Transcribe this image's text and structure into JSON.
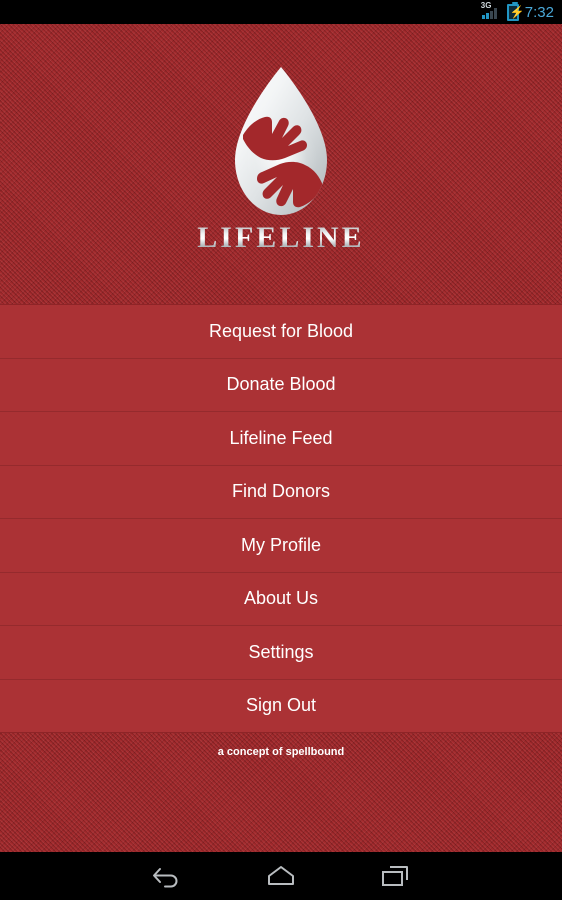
{
  "status_bar": {
    "network_label": "3G",
    "network_icon": "signal-bars-icon",
    "battery_icon": "battery-charging-icon",
    "time": "7:32",
    "time_color": "#4aa8d8",
    "accent_color": "#2196c4"
  },
  "brand": {
    "logo_icon": "blood-drop-hands-logo",
    "wordmark": "LIFELINE",
    "footer_note": "a concept of spellbound"
  },
  "theme": {
    "background_red": "#a3282b",
    "menu_red": "#ab3235",
    "divider_red": "#952a2d",
    "text_white": "#ffffff"
  },
  "menu": {
    "items": [
      {
        "label": "Request for Blood",
        "name": "menu-item-request-for-blood"
      },
      {
        "label": "Donate Blood",
        "name": "menu-item-donate-blood"
      },
      {
        "label": "Lifeline Feed",
        "name": "menu-item-lifeline-feed"
      },
      {
        "label": "Find Donors",
        "name": "menu-item-find-donors"
      },
      {
        "label": "My Profile",
        "name": "menu-item-my-profile"
      },
      {
        "label": "About Us",
        "name": "menu-item-about-us"
      },
      {
        "label": "Settings",
        "name": "menu-item-settings"
      },
      {
        "label": "Sign Out",
        "name": "menu-item-sign-out"
      }
    ]
  },
  "nav_bar": {
    "back_icon": "back-arrow-icon",
    "home_icon": "home-icon",
    "recents_icon": "recent-apps-icon"
  }
}
